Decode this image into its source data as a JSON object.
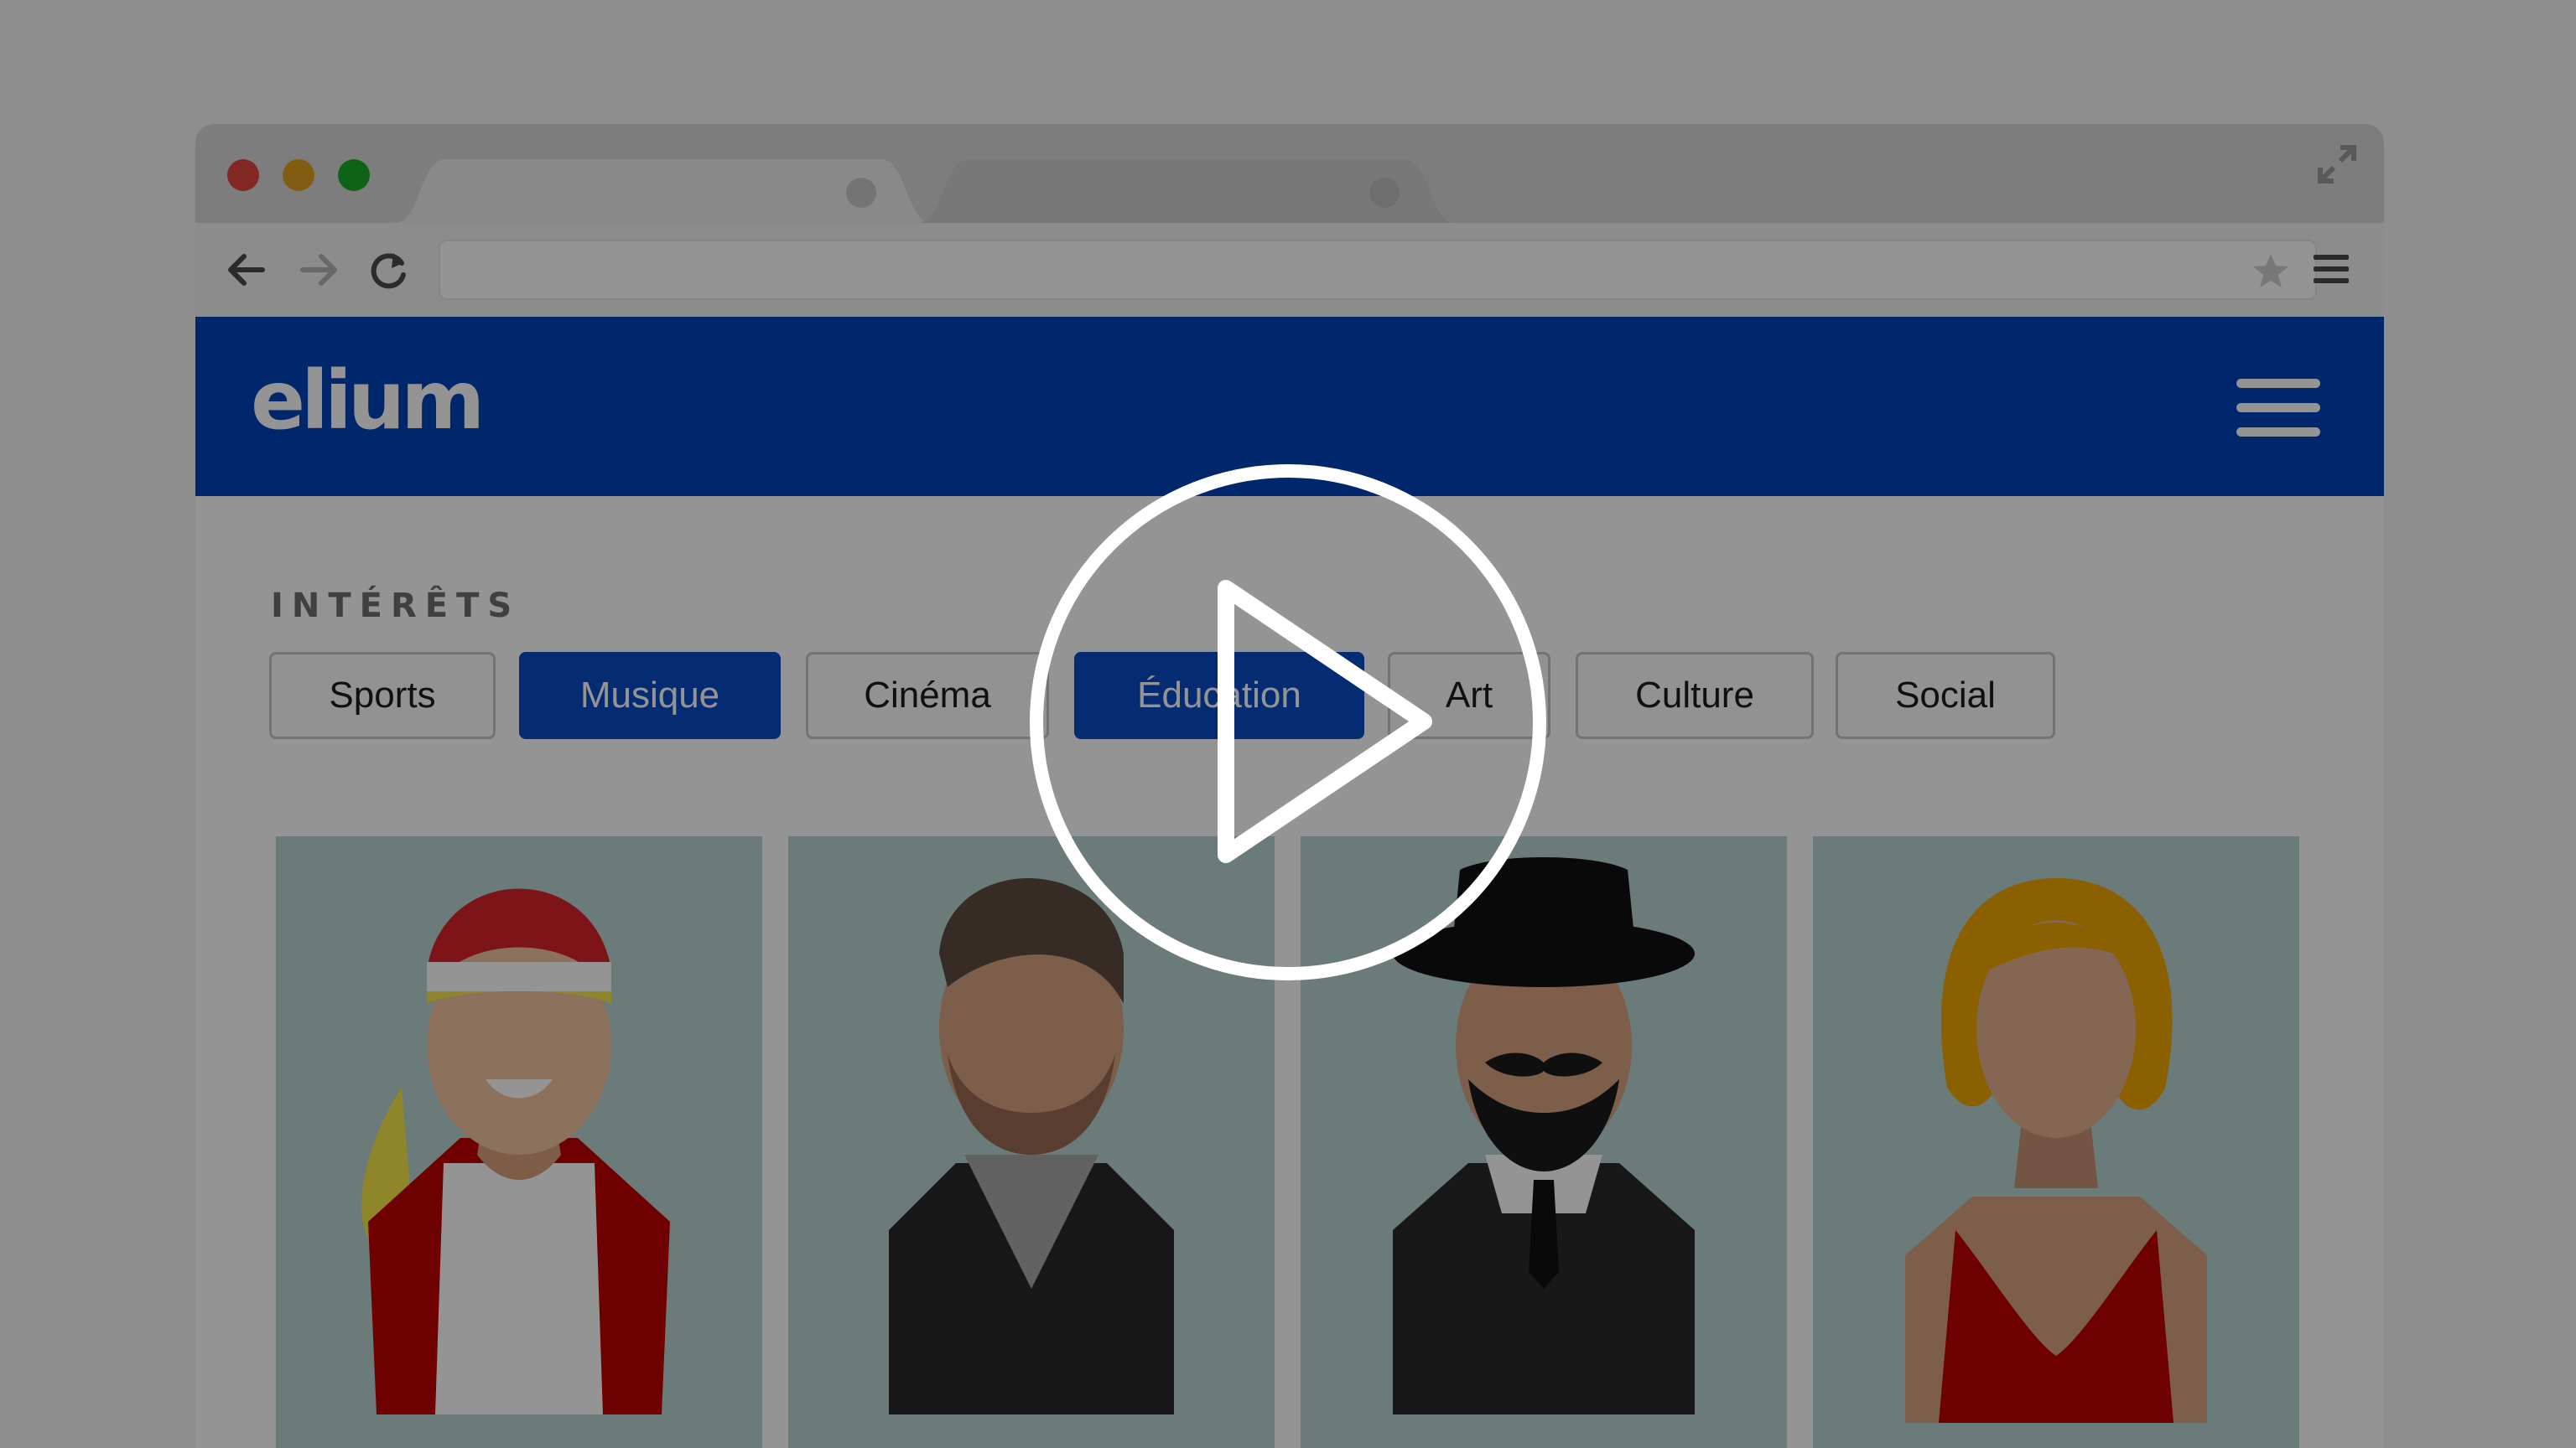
{
  "browser": {
    "window_controls": [
      "close",
      "minimize",
      "zoom"
    ],
    "tabs": [
      {
        "label": ""
      },
      {
        "label": ""
      }
    ],
    "url": "",
    "icons": {
      "back": "arrow-left-icon",
      "forward": "arrow-right-icon",
      "reload": "reload-icon",
      "bookmark": "star-icon",
      "menu": "menu-icon",
      "expand": "expand-icon"
    }
  },
  "app": {
    "logo": "elium",
    "brand_color": "#0042b8",
    "menu_icon": "hamburger-icon"
  },
  "interests": {
    "label": "INTÉRÊTS",
    "chips": [
      {
        "label": "Sports",
        "selected": false
      },
      {
        "label": "Musique",
        "selected": true
      },
      {
        "label": "Cinéma",
        "selected": false
      },
      {
        "label": "Éducation",
        "selected": true
      },
      {
        "label": "Art",
        "selected": false
      },
      {
        "label": "Culture",
        "selected": false
      },
      {
        "label": "Social",
        "selected": false
      }
    ]
  },
  "people": [
    {
      "name": "sporty-person-avatar"
    },
    {
      "name": "bearded-man-avatar"
    },
    {
      "name": "hat-mustache-man-avatar"
    },
    {
      "name": "red-hair-woman-avatar"
    }
  ],
  "video": {
    "play_icon": "play-icon",
    "overlay": true
  }
}
